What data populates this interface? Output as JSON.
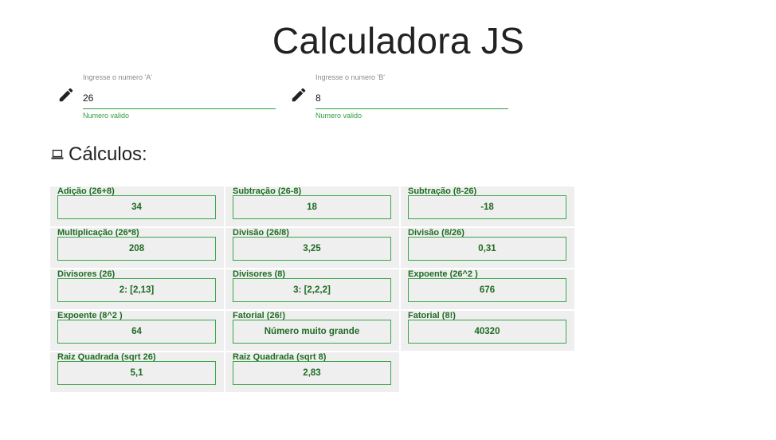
{
  "page_title": "Calculadora JS",
  "inputs": {
    "a": {
      "label": "Ingresse o numero 'A'",
      "value": "26",
      "hint": "Numero valido"
    },
    "b": {
      "label": "Ingresse o numero 'B'",
      "value": "8",
      "hint": "Numero valido"
    }
  },
  "section": {
    "title": "Cálculos:"
  },
  "results": [
    {
      "label": "Adição (26+8)",
      "value": "34"
    },
    {
      "label": "Subtração (26-8)",
      "value": "18"
    },
    {
      "label": "Subtração (8-26)",
      "value": "-18"
    },
    {
      "label": "Multiplicação (26*8)",
      "value": "208"
    },
    {
      "label": "Divisão (26/8)",
      "value": "3,25"
    },
    {
      "label": "Divisão (8/26)",
      "value": "0,31"
    },
    {
      "label": "Divisores (26)",
      "value": "2: [2,13]"
    },
    {
      "label": "Divisores (8)",
      "value": "3: [2,2,2]"
    },
    {
      "label": "Expoente (26^2 )",
      "value": "676"
    },
    {
      "label": "Expoente (8^2 )",
      "value": "64"
    },
    {
      "label": "Fatorial (26!)",
      "value": "Número muito grande"
    },
    {
      "label": "Fatorial (8!)",
      "value": "40320"
    },
    {
      "label": "Raiz Quadrada (sqrt 26)",
      "value": "5,1"
    },
    {
      "label": "Raiz Quadrada (sqrt 8)",
      "value": "2,83"
    }
  ],
  "colors": {
    "accent_green": "#2e9e3e",
    "result_text": "#1e6b21",
    "cell_bg": "#efefef"
  },
  "icons": {
    "edit": "pencil-icon",
    "section": "laptop-icon"
  }
}
